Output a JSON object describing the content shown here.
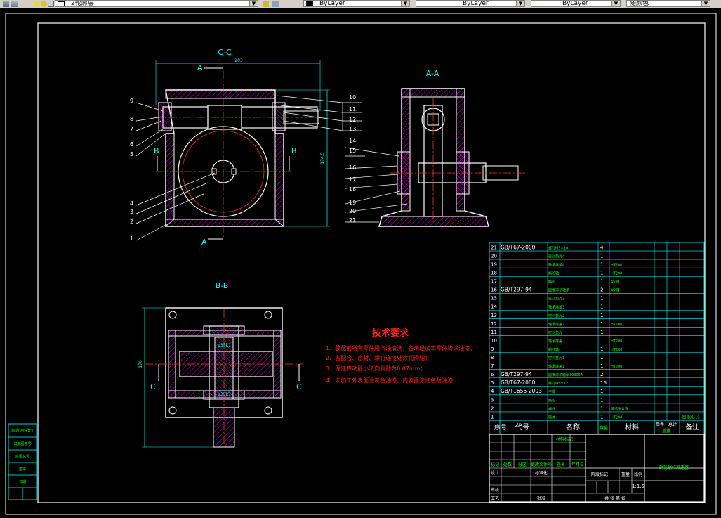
{
  "toolbar": {
    "layer_name": "2轮廓层",
    "color_combo": "ByLayer",
    "linetype_combo": "ByLayer",
    "lineweight_combo": "ByLayer",
    "plotstyle_combo": "随颜色"
  },
  "views": {
    "cc": {
      "title": "C-C",
      "section_mark_top": "A",
      "section_mark_bottom": "A",
      "section_mark_left": "B",
      "section_mark_right": "B",
      "dim_width": "203",
      "dim_height": "174.5",
      "left_labels": [
        "9",
        "8",
        "7",
        "6",
        "5",
        "4",
        "3",
        "2",
        "1"
      ],
      "right_labels": [
        "10",
        "11",
        "12",
        "13"
      ]
    },
    "aa": {
      "title": "A-A",
      "labels": [
        "14",
        "15",
        "16",
        "17",
        "18",
        "19",
        "20",
        "21"
      ]
    },
    "bb": {
      "title": "B-B",
      "section_mark_left": "C",
      "section_mark_right": "C",
      "dim_side": "176",
      "fit_top": "φ35k7",
      "fit_bottom": "φ35k7"
    }
  },
  "tech": {
    "title": "技术要求",
    "lines": [
      "1、装配前所有零件用汽油清洗，各未经加工零件均涂油漆；",
      "2、各配合、密封、螺钉连接处涂润滑脂；",
      "3、保证传动最小法向侧隙为0.07mm；",
      "4、未加工外表面涂灰色油漆，内表面涂红色耐油漆"
    ]
  },
  "bom": {
    "rows": [
      {
        "no": "21",
        "code": "GB/T67-2000",
        "name": "螺钉M5×10",
        "qty": "4",
        "mat": ""
      },
      {
        "no": "20",
        "code": "",
        "name": "密封垫片4",
        "qty": "1",
        "mat": ""
      },
      {
        "no": "19",
        "code": "",
        "name": "轴承端盖4",
        "qty": "1",
        "mat": "HT200"
      },
      {
        "no": "18",
        "code": "",
        "name": "蜗轮轴",
        "qty": "1",
        "mat": "HT200"
      },
      {
        "no": "17",
        "code": "",
        "name": "蜗轮",
        "qty": "1",
        "mat": "45钢"
      },
      {
        "no": "16",
        "code": "GB/T297-94",
        "name": "圆锥滚子轴承",
        "qty": "2",
        "mat": "45钢"
      },
      {
        "no": "15",
        "code": "",
        "name": "密封垫片3",
        "qty": "1",
        "mat": ""
      },
      {
        "no": "14",
        "code": "",
        "name": "轴承端盖3",
        "qty": "1",
        "mat": ""
      },
      {
        "no": "13",
        "code": "",
        "name": "密封垫片2",
        "qty": "1",
        "mat": ""
      },
      {
        "no": "12",
        "code": "",
        "name": "轴承端盖2",
        "qty": "1",
        "mat": "HT200"
      },
      {
        "no": "11",
        "code": "",
        "name": "密封垫片",
        "qty": "1",
        "mat": ""
      },
      {
        "no": "10",
        "code": "",
        "name": "轴承端盖",
        "qty": "1",
        "mat": "HT200"
      },
      {
        "no": "9",
        "code": "",
        "name": "蜗杆轴",
        "qty": "1",
        "mat": "HT200"
      },
      {
        "no": "8",
        "code": "",
        "name": "密封垫片1",
        "qty": "1",
        "mat": ""
      },
      {
        "no": "7",
        "code": "",
        "name": "轴承端盖1",
        "qty": "1",
        "mat": "HT200"
      },
      {
        "no": "6",
        "code": "GB/T297-94",
        "name": "圆锥滚子轴承30305A",
        "qty": "2",
        "mat": ""
      },
      {
        "no": "5",
        "code": "GB/T67-2000",
        "name": "螺钉M5×12",
        "qty": "16",
        "mat": ""
      },
      {
        "no": "4",
        "code": "GB/T1656-2003",
        "name": "平键",
        "qty": "1",
        "mat": ""
      },
      {
        "no": "3",
        "code": "",
        "name": "蜗轮",
        "qty": "1",
        "mat": ""
      },
      {
        "no": "2",
        "code": "",
        "name": "蜗杆",
        "qty": "1",
        "mat": "铸造锡青铜"
      },
      {
        "no": "1",
        "code": "",
        "name": "箱体",
        "qty": "1",
        "mat": "HT200",
        "note": "图号01-18"
      }
    ],
    "header": {
      "no": "序号",
      "code": "代号",
      "name": "名称",
      "qty": "数量",
      "mat": "材料",
      "unit": "单件",
      "total": "总计",
      "weight": "重量",
      "note": "备注"
    }
  },
  "title_block": {
    "drawing_title": "蜗轮蜗杆减速器",
    "scale": "1:1.5",
    "row_labels": [
      "标记",
      "处数",
      "分区",
      "更改文件号",
      "签名",
      "年月日"
    ],
    "design": "设计",
    "standard": "标准化",
    "review": "审核",
    "process": "工艺",
    "approve": "批准",
    "stage": "阶段标记",
    "weight": "重量",
    "ratio": "比例",
    "sheets": "共 张 第 张",
    "material_label": "材料标记"
  },
  "left_strip": [
    "借(通)用件登记",
    "旧底图总号",
    "底图总号",
    "签字",
    "日期"
  ],
  "colors": {
    "border": "#ffffff",
    "outline": "#ffffff",
    "hatch": "#ff00ff",
    "center": "#ff3030",
    "dimension": "#00ffff",
    "text_green": "#00ff00",
    "tech_title": "#ff2020",
    "tech_text": "#ff2020"
  }
}
